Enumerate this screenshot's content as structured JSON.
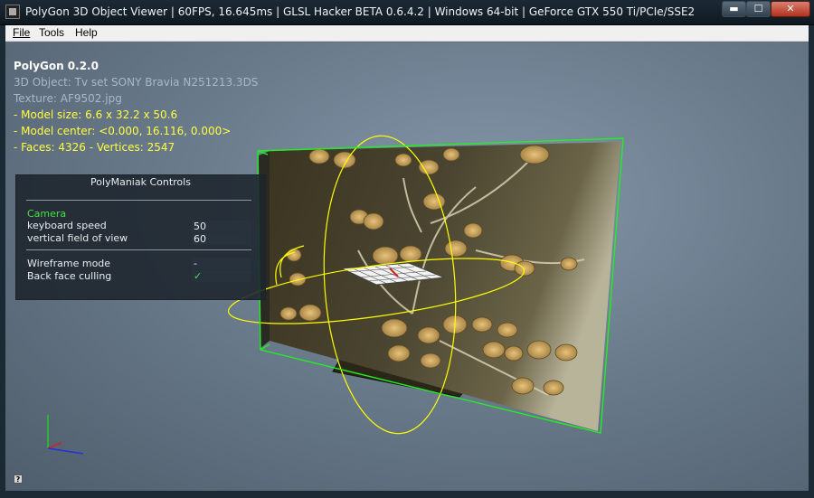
{
  "window": {
    "title": "PolyGon 3D Object Viewer | 60FPS, 16.645ms | GLSL Hacker BETA 0.6.4.2 | Windows 64-bit | GeForce GTX 550 Ti/PCIe/SSE2",
    "minimize": "▬",
    "maximize": "☐",
    "close": "✕"
  },
  "menu": {
    "file": "File",
    "tools": "Tools",
    "help": "Help"
  },
  "info": {
    "app": "PolyGon 0.2.0",
    "object": "3D Object: Tv set SONY Bravia N251213.3DS",
    "texture": "Texture: AF9502.jpg",
    "size": "- Model size:  6.6 x 32.2 x 50.6",
    "center": "- Model center:  <0.000, 16.116, 0.000>",
    "faces": "- Faces: 4326 - Vertices: 2547"
  },
  "panel": {
    "title": "PolyManiak Controls",
    "camera": "Camera",
    "keyboard_speed_label": "keyboard speed",
    "keyboard_speed": "50",
    "fov_label": "vertical field of view",
    "fov": "60",
    "wireframe_label": "Wireframe mode",
    "wireframe": "-",
    "backface_label": "Back face culling",
    "backface": "✓"
  },
  "help_button": "?",
  "colors": {
    "bounding_box": "#22ee22",
    "gizmo": "#ffff00",
    "axis_x": "#cc2222",
    "axis_y": "#22cc22",
    "axis_z": "#2233dd"
  }
}
